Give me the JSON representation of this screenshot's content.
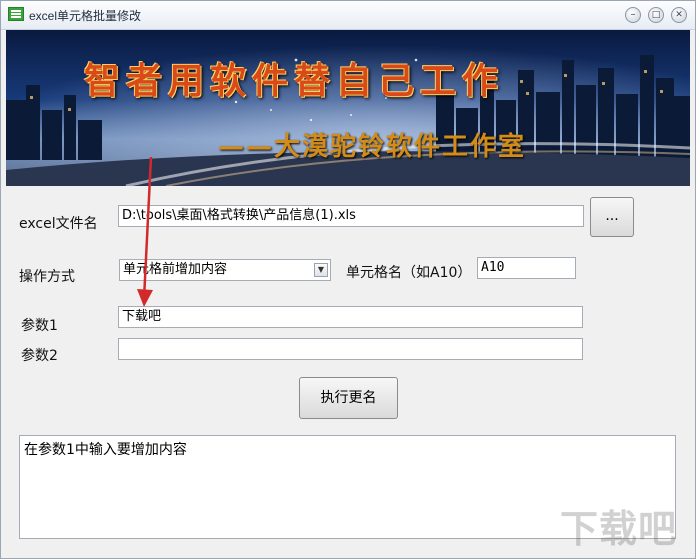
{
  "window": {
    "title": "excel单元格批量修改"
  },
  "banner": {
    "title": "智者用软件替自己工作",
    "subtitle": "——大漠驼铃软件工作室"
  },
  "file": {
    "label": "excel文件名",
    "value": "D:\\tools\\桌面\\格式转换\\产品信息(1).xls",
    "browse_label": "..."
  },
  "operation": {
    "label": "操作方式",
    "selected": "单元格前增加内容"
  },
  "cell": {
    "label": "单元格名（如A10）",
    "value": "A10"
  },
  "param1": {
    "label": "参数1",
    "value": "下载吧"
  },
  "param2": {
    "label": "参数2",
    "value": ""
  },
  "execute": {
    "label": "执行更名"
  },
  "hint": {
    "text": "在参数1中输入要增加内容"
  },
  "watermark": {
    "text": "下载吧"
  },
  "colors": {
    "arrow": "#d22a2a",
    "banner_title": "#d94a1a",
    "banner_subtitle": "#d48c18"
  }
}
